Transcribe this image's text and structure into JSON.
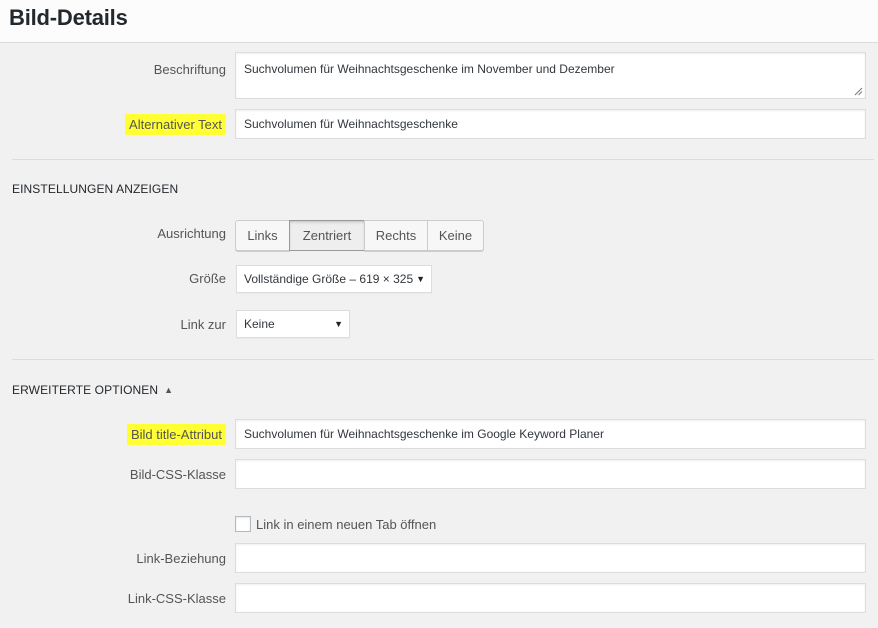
{
  "header": {
    "title": "Bild-Details"
  },
  "caption": {
    "label": "Beschriftung",
    "value": "Suchvolumen für Weihnachtsgeschenke im November und Dezember"
  },
  "alt_text": {
    "label": "Alternativer Text",
    "value": "Suchvolumen für Weihnachtsgeschenke",
    "highlight_color": "#ffff33"
  },
  "display_settings": {
    "title": "EINSTELLUNGEN ANZEIGEN",
    "alignment": {
      "label": "Ausrichtung",
      "options": [
        "Links",
        "Zentriert",
        "Rechts",
        "Keine"
      ],
      "selected": "Zentriert"
    },
    "size": {
      "label": "Größe",
      "value": "Vollständige Größe – 619 × 325"
    },
    "link_to": {
      "label": "Link zur",
      "value": "Keine"
    }
  },
  "advanced": {
    "title": "ERWEITERTE OPTIONEN",
    "toggle_icon": "triangle-up-icon",
    "title_attribute": {
      "label": "Bild title-Attribut",
      "value": "Suchvolumen für Weihnachtsgeschenke im Google Keyword Planer"
    },
    "css_class": {
      "label": "Bild-CSS-Klasse",
      "value": ""
    },
    "new_tab": {
      "label": "Link in einem neuen Tab öffnen",
      "checked": false
    },
    "link_rel": {
      "label": "Link-Beziehung",
      "value": ""
    },
    "link_css_class": {
      "label": "Link-CSS-Klasse",
      "value": ""
    }
  }
}
